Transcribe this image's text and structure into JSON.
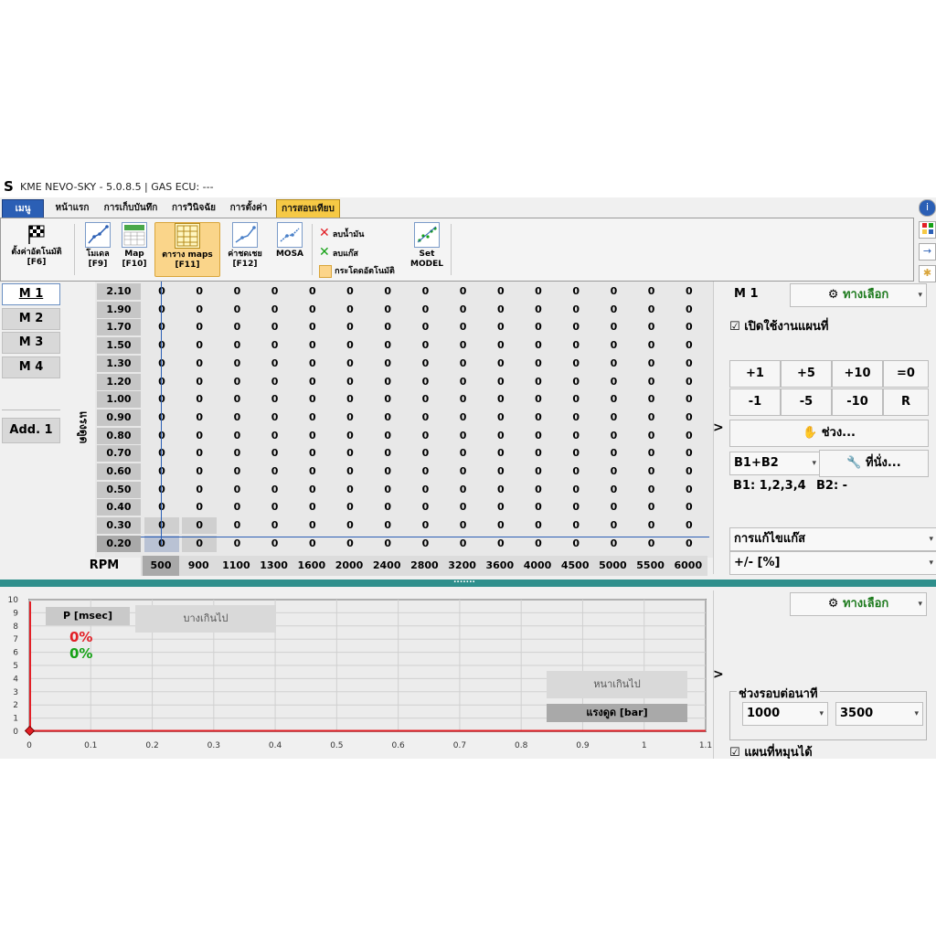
{
  "window": {
    "title": "KME NEVO-SKY - 5.0.8.5 | GAS ECU: ---"
  },
  "tabs": [
    "เมนู",
    "หน้าแรก",
    "การเก็บบันทึก",
    "การวินิจฉัย",
    "การตั้งค่า",
    "การสอบเทียบ"
  ],
  "ribbon": {
    "auto_calib": "ตั้งค่าอัตโนมัติ",
    "auto_calib_key": "[F6]",
    "model": "โมเดล",
    "model_key": "[F9]",
    "map": "Map",
    "map_key": "[F10]",
    "maps_table": "ตาราง maps",
    "maps_table_key": "[F11]",
    "compensation": "ค่าชดเชย",
    "compensation_key": "[F12]",
    "mosa": "MOSA",
    "delete_petrol": "ลบน้ำมัน",
    "delete_gas": "ลบแก๊ส",
    "auto_jump": "กระโดดอัตโนมัติ",
    "set_model_1": "Set",
    "set_model_2": "MODEL"
  },
  "maps": [
    "M 1",
    "M 2",
    "M 3",
    "M 4"
  ],
  "add_map": "Add. 1",
  "grid": {
    "y_axis_label": "แรงดูด",
    "rpm_label": "RPM",
    "pressures": [
      "2.10",
      "1.90",
      "1.70",
      "1.50",
      "1.30",
      "1.20",
      "1.00",
      "0.90",
      "0.80",
      "0.70",
      "0.60",
      "0.50",
      "0.40",
      "0.30",
      "0.20"
    ],
    "rpms": [
      "500",
      "900",
      "1100",
      "1300",
      "1600",
      "2000",
      "2400",
      "2800",
      "3200",
      "3600",
      "4000",
      "4500",
      "5000",
      "5500",
      "6000"
    ],
    "cell_value": "0"
  },
  "right_panel": {
    "map_name": "M 1",
    "options": "ทางเลือก",
    "enable_map": "เปิดใช้งานแผนที่",
    "buttons": [
      "+1",
      "+5",
      "+10",
      "=0",
      "-1",
      "-5",
      "-10",
      "R"
    ],
    "range": "ช่วง...",
    "bank": "B1+B2",
    "seat": "ที่นั่ง...",
    "b1": "B1: 1,2,3,4",
    "b2": "B2: -",
    "correction": "การแก้ไขแก๊ส",
    "unit": "+/- [%]"
  },
  "expander": ">",
  "chart": {
    "y_ticks": [
      "10",
      "9",
      "8",
      "7",
      "6",
      "5",
      "4",
      "3",
      "2",
      "1",
      "0"
    ],
    "x_ticks": [
      "0",
      "0.1",
      "0.2",
      "0.3",
      "0.4",
      "0.5",
      "0.6",
      "0.7",
      "0.8",
      "0.9",
      "1",
      "1.1"
    ],
    "p_label": "P [msec]",
    "too_thin": "บางเกินไป",
    "too_thick": "หนาเกินไป",
    "pressure_label": "แรงดูด [bar]",
    "val_red": "0%",
    "val_green": "0%",
    "colors": {
      "red": "#e21f26",
      "green": "#16a116"
    }
  },
  "bottom_right": {
    "options": "ทางเลือก",
    "rpm_range": "ช่วงรอบต่อนาที",
    "rpm_min": "1000",
    "rpm_max": "3500",
    "rotatable": "แผนที่หมุนได้"
  },
  "splitter": "......."
}
